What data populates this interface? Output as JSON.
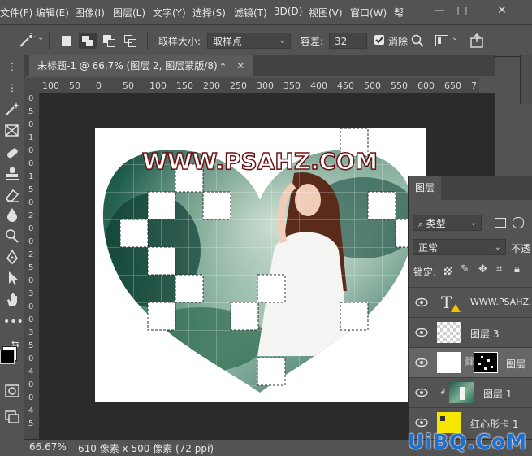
{
  "menubar": {
    "items": [
      "文件(F)",
      "编辑(E)",
      "图像(I)",
      "图层(L)",
      "文字(Y)",
      "选择(S)",
      "滤镜(T)",
      "3D(D)",
      "视图(V)",
      "窗口(W)",
      "帮"
    ]
  },
  "options": {
    "sample_size_label": "取样大小:",
    "sample_size_value": "取样点",
    "tolerance_label": "容差:",
    "tolerance_value": "32",
    "antialias_label": "消除"
  },
  "document": {
    "tab_title": "未标题-1 @ 66.7% (图层 2, 图层蒙版/8) *",
    "watermark_text": "WWW.PSAHZ.COM"
  },
  "rulers": {
    "h_ticks": [
      "100",
      "50",
      "0",
      "50",
      "100",
      "150",
      "200",
      "250",
      "300",
      "350",
      "400",
      "450",
      "500",
      "550",
      "600",
      "650",
      "7"
    ],
    "v_ticks": [
      "0",
      "5",
      "0",
      "1",
      "0",
      "0",
      "1",
      "5",
      "0",
      "2",
      "0",
      "0",
      "2",
      "5",
      "0",
      "3",
      "0",
      "0",
      "3",
      "5",
      "0",
      "4",
      "0",
      "0",
      "4",
      "5"
    ]
  },
  "layers_panel": {
    "title": "图层",
    "filter_type": "类型",
    "blend_mode": "正常",
    "opacity_label": "不透",
    "lock_label": "锁定:",
    "layers": [
      {
        "name": "WWW.PSAHZ.COM",
        "kind": "text"
      },
      {
        "name": "图层 3",
        "kind": "transparent"
      },
      {
        "name": "图层",
        "kind": "masked"
      },
      {
        "name": "图层 1",
        "kind": "photo"
      },
      {
        "name": "红心形卡 1",
        "kind": "shape"
      }
    ]
  },
  "status": {
    "zoom": "66.67%",
    "doc_info": "610 像素 x 500 像素 (72 ppi)"
  },
  "site_watermark": "UiBQ.CoM",
  "colors": {
    "ui_bg": "#535353",
    "canvas_bg": "#2b2b2b",
    "tab_bg": "#424242"
  }
}
